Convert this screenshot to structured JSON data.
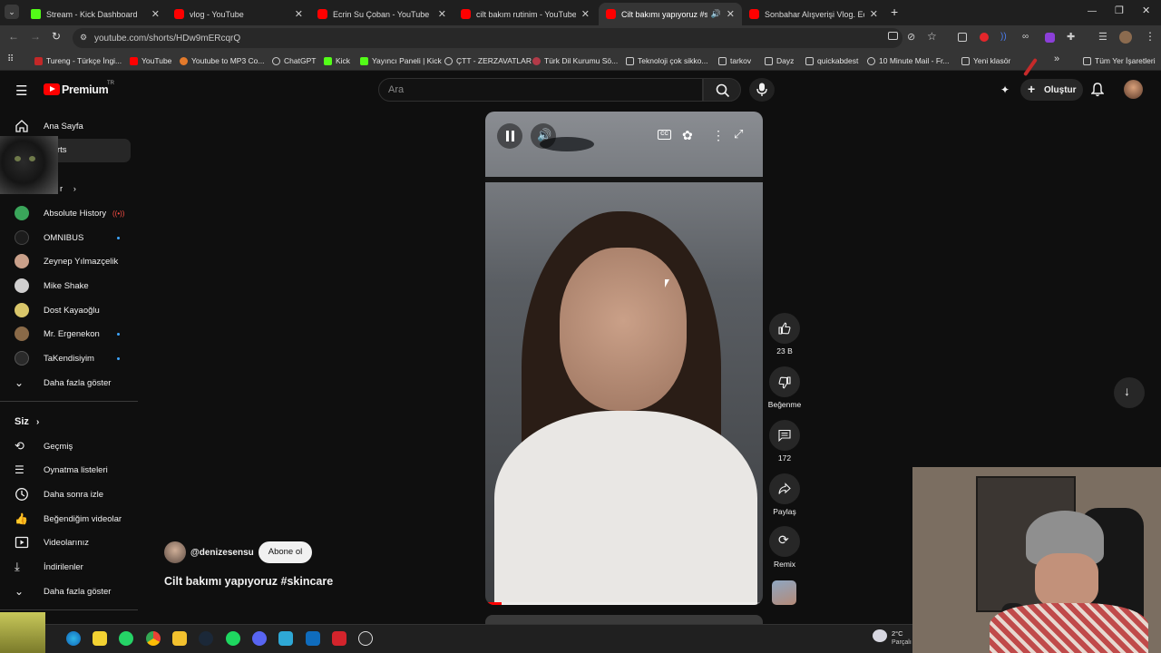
{
  "browser": {
    "tabs": [
      {
        "title": "Stream - Kick Dashboard",
        "icon": "kick-icon"
      },
      {
        "title": "vlog - YouTube",
        "icon": "youtube-icon"
      },
      {
        "title": "Ecrin Su Çoban - YouTube",
        "icon": "youtube-icon"
      },
      {
        "title": "cilt bakım rutinim - YouTube",
        "icon": "youtube-icon"
      },
      {
        "title": "Cilt bakımı yapıyoruz #skinc",
        "icon": "youtube-icon"
      },
      {
        "title": "Sonbahar Alışverişi Vlog. Ecrin",
        "icon": "youtube-icon"
      }
    ],
    "new_tab": "+",
    "url": "youtube.com/shorts/HDw9mERcqrQ",
    "bookmarks": [
      "Tureng - Türkçe İngi...",
      "YouTube",
      "Youtube to MP3 Co...",
      "ChatGPT",
      "Kick",
      "Yayıncı Paneli | Kick",
      "ÇTT - ZERZAVATLAR",
      "Türk Dil Kurumu Sö...",
      "Teknoloji çok sikko...",
      "tarkov",
      "Dayz",
      "quickabdest",
      "10 Minute Mail - Fr...",
      "Yeni klasör"
    ],
    "bookmarks_more": "»",
    "all_bookmarks": "Tüm Yer İşaretleri"
  },
  "youtube": {
    "logo": "Premium",
    "logo_region": "TR",
    "search_placeholder": "Ara",
    "create_label": "Oluştur"
  },
  "sidebar": {
    "home": "Ana Sayfa",
    "shorts": "rts",
    "subs_header": "r",
    "subscriptions": [
      {
        "name": "Absolute History",
        "live": true,
        "dot": false,
        "color": "#3aa55a"
      },
      {
        "name": "OMNIBUS",
        "live": false,
        "dot": true,
        "color": "#1c1c1c"
      },
      {
        "name": "Zeynep Yılmazçelik",
        "live": false,
        "dot": false,
        "color": "#c9a08a"
      },
      {
        "name": "Mike Shake",
        "live": false,
        "dot": false,
        "color": "#d0cfcf"
      },
      {
        "name": "Dost Kayaoğlu",
        "live": false,
        "dot": false,
        "color": "#d9c66a"
      },
      {
        "name": "Mr. Ergenekon",
        "live": false,
        "dot": true,
        "color": "#8a6a48"
      },
      {
        "name": "TaKendisiyim",
        "live": false,
        "dot": true,
        "color": "#2a2a2a"
      }
    ],
    "show_more_1": "Daha fazla göster",
    "you_header": "Siz",
    "you_items": [
      "Geçmiş",
      "Oynatma listeleri",
      "Daha sonra izle",
      "Beğendiğim videolar",
      "Videolarınız",
      "İndirilenler"
    ],
    "show_more_2": "Daha fazla göster"
  },
  "short": {
    "channel": "@denizesensu",
    "subscribe": "Abone ol",
    "title": "Cilt bakımı yapıyoruz #skincare",
    "likes": "23 B",
    "dislike_label": "Beğenme",
    "comments": "172",
    "share_label": "Paylaş",
    "remix_label": "Remix"
  },
  "taskbar": {
    "temperature": "2°C",
    "weather_text": "Parçalı"
  },
  "colors": {
    "youtube_red": "#ff0000",
    "kick_green": "#53fc18",
    "link_blue": "#3ea6ff"
  }
}
